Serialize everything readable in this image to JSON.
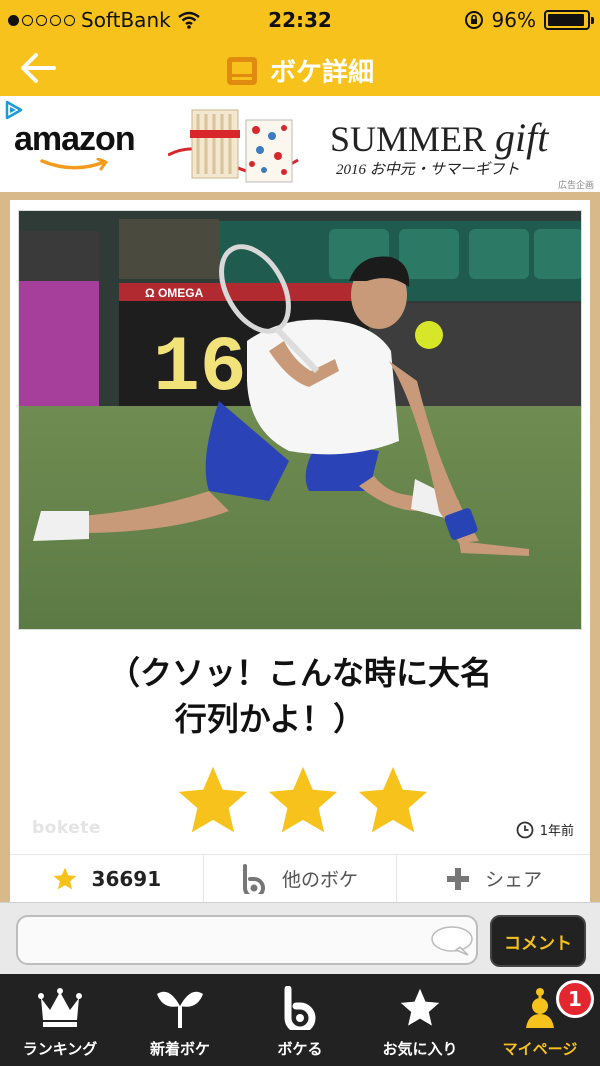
{
  "status_bar": {
    "carrier": "SoftBank",
    "signal_bars_filled": 1,
    "signal_bars_total": 5,
    "time": "22:32",
    "battery": "96%",
    "battery_level": 0.96
  },
  "nav": {
    "title": "ボケ詳細",
    "back_icon": "arrow-left-icon",
    "title_icon": "monitor-icon"
  },
  "ad": {
    "brand": "amazon",
    "headline_main": "SUMMER",
    "headline_script": "gift",
    "subline": "2016 お中元・サマーギフト",
    "label": "広告企画"
  },
  "post": {
    "image_scoreboard_text": "16",
    "image_brand_text": "Ω OMEGA",
    "caption_lines": [
      "（クソッ！こんな時に大名",
      "行列かよ！）"
    ],
    "rating_stars": 3,
    "watermark": "bokete",
    "posted_ago": "1年前",
    "stats": {
      "stars_count": "36691",
      "other_bokes_label": "他のボケ",
      "share_label": "シェア"
    }
  },
  "comment": {
    "placeholder": "",
    "button_label": "コメント"
  },
  "tabs": [
    {
      "label": "ランキング",
      "icon": "crown-icon",
      "active": false
    },
    {
      "label": "新着ボケ",
      "icon": "sprout-icon",
      "active": false
    },
    {
      "label": "ボケる",
      "icon": "bokete-b-icon",
      "active": false
    },
    {
      "label": "お気に入り",
      "icon": "star-icon",
      "active": false
    },
    {
      "label": "マイページ",
      "icon": "user-icon",
      "active": true,
      "badge": "1"
    }
  ],
  "colors": {
    "accent": "#f6c21b",
    "star": "#f6c21b",
    "tabbar": "#222222",
    "badge": "#e3262f",
    "background": "#d8b98a"
  }
}
